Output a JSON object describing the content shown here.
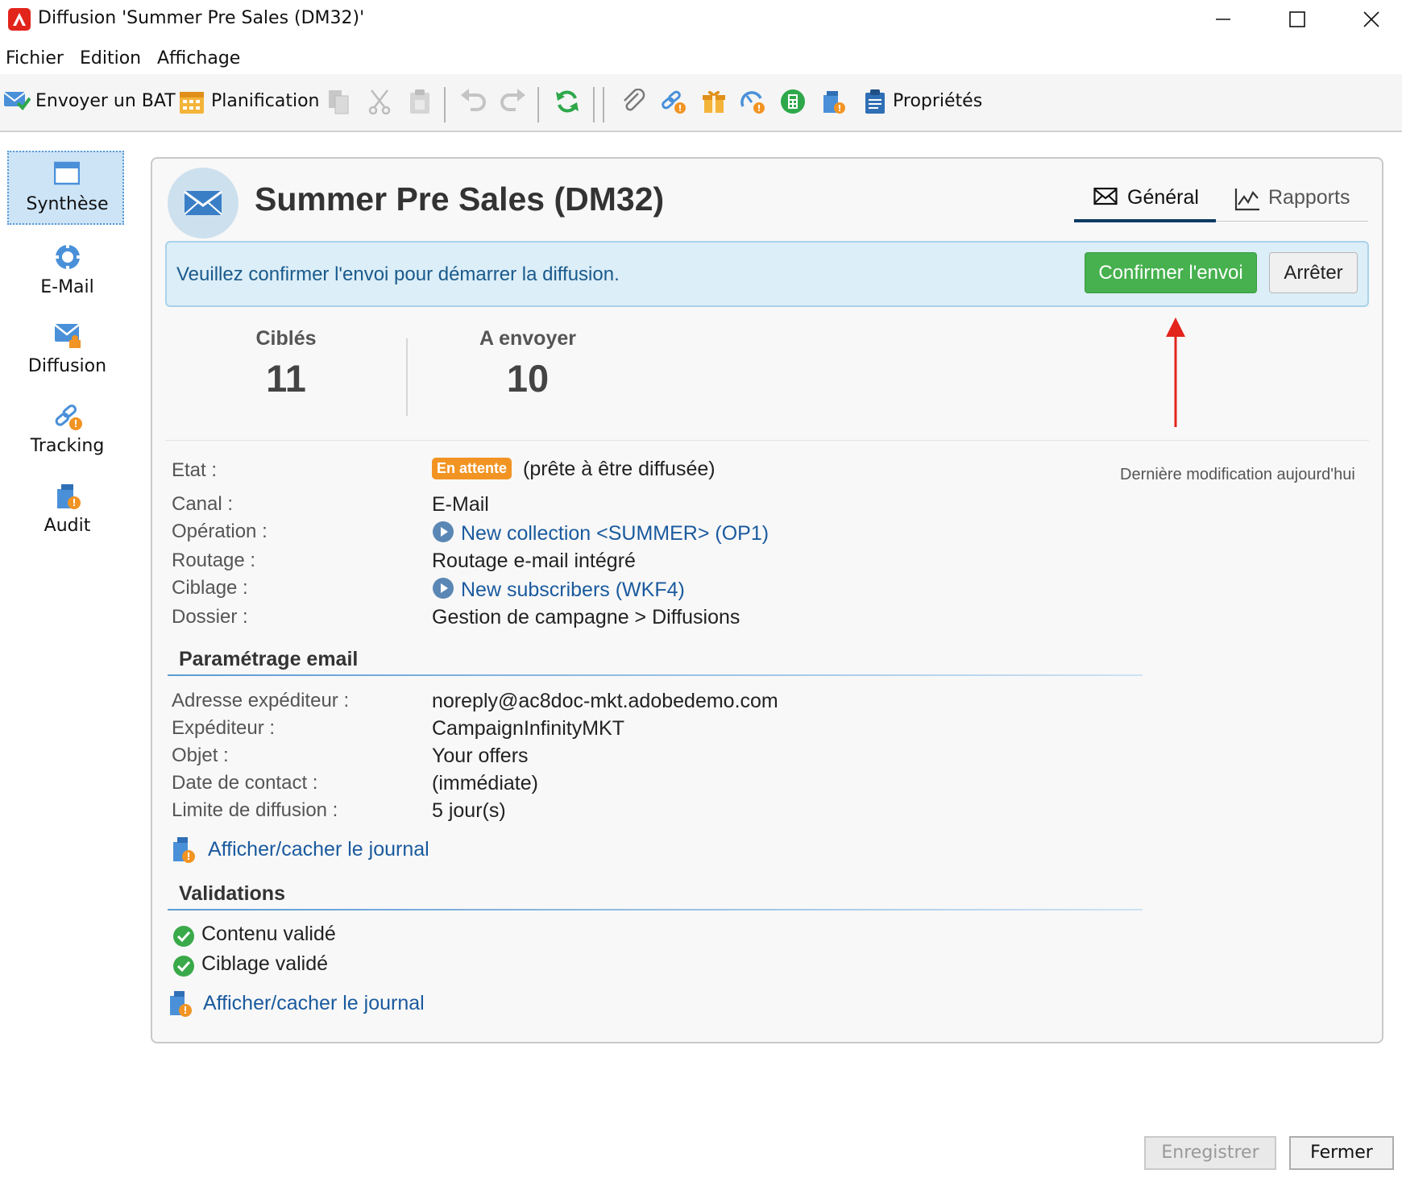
{
  "window": {
    "title": "Diffusion 'Summer Pre Sales (DM32)'"
  },
  "menu": {
    "items": [
      "Fichier",
      "Edition",
      "Affichage"
    ]
  },
  "toolbar": {
    "send_proof_label": "Envoyer un BAT",
    "schedule_label": "Planification",
    "properties_label": "Propriétés"
  },
  "nav": {
    "items": [
      {
        "label": "Synthèse",
        "icon": "summary-icon",
        "active": true
      },
      {
        "label": "E-Mail",
        "icon": "email-channel-icon"
      },
      {
        "label": "Diffusion",
        "icon": "delivery-icon"
      },
      {
        "label": "Tracking",
        "icon": "tracking-icon"
      },
      {
        "label": "Audit",
        "icon": "audit-icon"
      }
    ]
  },
  "header": {
    "title": "Summer Pre Sales (DM32)",
    "tabs": [
      {
        "label": "Général",
        "icon": "envelope-icon",
        "active": true
      },
      {
        "label": "Rapports",
        "icon": "chart-icon",
        "active": false
      }
    ]
  },
  "banner": {
    "message": "Veuillez confirmer l'envoi pour démarrer la diffusion.",
    "confirm_label": "Confirmer l'envoi",
    "stop_label": "Arrêter"
  },
  "stats": {
    "targeted_label": "Ciblés",
    "targeted_value": "11",
    "to_send_label": "A envoyer",
    "to_send_value": "10"
  },
  "summary": {
    "state_label": "Etat :",
    "state_badge": "En attente",
    "state_text": "(prête à être diffusée)",
    "last_modified": "Dernière modification aujourd'hui",
    "channel_label": "Canal :",
    "channel_value": "E-Mail",
    "operation_label": "Opération :",
    "operation_value": "New collection <SUMMER> (OP1)",
    "routing_label": "Routage :",
    "routing_value": "Routage e-mail intégré",
    "targeting_label": "Ciblage :",
    "targeting_value": "New subscribers (WKF4)",
    "folder_label": "Dossier :",
    "folder_value": "Gestion de campagne > Diffusions"
  },
  "email_settings": {
    "title": "Paramétrage email",
    "sender_address_label": "Adresse expéditeur :",
    "sender_address_value": "noreply@ac8doc-mkt.adobedemo.com",
    "sender_label": "Expéditeur :",
    "sender_value": "CampaignInfinityMKT",
    "subject_label": "Objet :",
    "subject_value": "Your offers",
    "contact_date_label": "Date de contact :",
    "contact_date_value": "(immédiate)",
    "delivery_limit_label": "Limite de diffusion :",
    "delivery_limit_value": "5 jour(s)",
    "journal_link": "Afficher/cacher le journal"
  },
  "validations": {
    "title": "Validations",
    "content_valid": "Contenu validé",
    "targeting_valid": "Ciblage validé",
    "journal_link": "Afficher/cacher le journal"
  },
  "footer": {
    "save_label": "Enregistrer",
    "close_label": "Fermer"
  },
  "colors": {
    "confirm_green": "#46b14e",
    "banner_bg": "#dceef7",
    "badge_orange": "#f29423",
    "link_blue": "#1a5a9e",
    "annotation_red": "#e3241c"
  }
}
